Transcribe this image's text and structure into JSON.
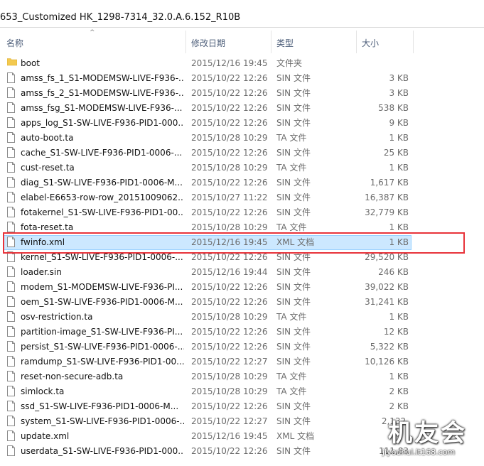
{
  "address_bar": {
    "path": "653_Customized HK_1298-7314_32.0.A.6.152_R10B"
  },
  "columns": {
    "name": "名称",
    "date": "修改日期",
    "type": "类型",
    "size": "大小"
  },
  "selected_index": 12,
  "files": [
    {
      "name": "boot",
      "date": "2015/12/16 19:45",
      "type": "文件夹",
      "size": "",
      "icon": "folder-icon"
    },
    {
      "name": "amss_fs_1_S1-MODEMSW-LIVE-F936-...",
      "date": "2015/10/22 12:26",
      "type": "SIN 文件",
      "size": "3 KB",
      "icon": "file-icon"
    },
    {
      "name": "amss_fs_2_S1-MODEMSW-LIVE-F936-...",
      "date": "2015/10/22 12:26",
      "type": "SIN 文件",
      "size": "3 KB",
      "icon": "file-icon"
    },
    {
      "name": "amss_fsg_S1-MODEMSW-LIVE-F936-...",
      "date": "2015/10/22 12:26",
      "type": "SIN 文件",
      "size": "538 KB",
      "icon": "file-icon"
    },
    {
      "name": "apps_log_S1-SW-LIVE-F936-PID1-000...",
      "date": "2015/10/22 12:26",
      "type": "SIN 文件",
      "size": "9 KB",
      "icon": "file-icon"
    },
    {
      "name": "auto-boot.ta",
      "date": "2015/10/28 10:29",
      "type": "TA 文件",
      "size": "1 KB",
      "icon": "file-icon"
    },
    {
      "name": "cache_S1-SW-LIVE-F936-PID1-0006-...",
      "date": "2015/10/22 12:26",
      "type": "SIN 文件",
      "size": "25 KB",
      "icon": "file-icon"
    },
    {
      "name": "cust-reset.ta",
      "date": "2015/10/28 10:29",
      "type": "TA 文件",
      "size": "1 KB",
      "icon": "file-icon"
    },
    {
      "name": "diag_S1-SW-LIVE-F936-PID1-0006-M...",
      "date": "2015/10/22 12:26",
      "type": "SIN 文件",
      "size": "1,617 KB",
      "icon": "file-icon"
    },
    {
      "name": "elabel-E6653-row-row_20151009062...",
      "date": "2015/10/27 11:22",
      "type": "SIN 文件",
      "size": "16,387 KB",
      "icon": "file-icon"
    },
    {
      "name": "fotakernel_S1-SW-LIVE-F936-PID1-00...",
      "date": "2015/10/22 12:26",
      "type": "SIN 文件",
      "size": "32,779 KB",
      "icon": "file-icon"
    },
    {
      "name": "fota-reset.ta",
      "date": "2015/10/28 10:29",
      "type": "TA 文件",
      "size": "1 KB",
      "icon": "file-icon"
    },
    {
      "name": "fwinfo.xml",
      "date": "2015/12/16 19:45",
      "type": "XML 文档",
      "size": "1 KB",
      "icon": "file-icon"
    },
    {
      "name": "kernel_S1-SW-LIVE-F936-PID1-0006-...",
      "date": "2015/10/22 12:26",
      "type": "SIN 文件",
      "size": "29,520 KB",
      "icon": "file-icon"
    },
    {
      "name": "loader.sin",
      "date": "2015/12/16 19:44",
      "type": "SIN 文件",
      "size": "246 KB",
      "icon": "file-icon"
    },
    {
      "name": "modem_S1-MODEMSW-LIVE-F936-PI...",
      "date": "2015/10/22 12:26",
      "type": "SIN 文件",
      "size": "39,022 KB",
      "icon": "file-icon"
    },
    {
      "name": "oem_S1-SW-LIVE-F936-PID1-0006-M...",
      "date": "2015/10/22 12:26",
      "type": "SIN 文件",
      "size": "31,241 KB",
      "icon": "file-icon"
    },
    {
      "name": "osv-restriction.ta",
      "date": "2015/10/28 10:29",
      "type": "TA 文件",
      "size": "1 KB",
      "icon": "file-icon"
    },
    {
      "name": "partition-image_S1-SW-LIVE-F936-PI...",
      "date": "2015/10/22 12:26",
      "type": "SIN 文件",
      "size": "12 KB",
      "icon": "file-icon"
    },
    {
      "name": "persist_S1-SW-LIVE-F936-PID1-0006-...",
      "date": "2015/10/22 12:26",
      "type": "SIN 文件",
      "size": "5,322 KB",
      "icon": "file-icon"
    },
    {
      "name": "ramdump_S1-SW-LIVE-F936-PID1-00...",
      "date": "2015/10/22 12:27",
      "type": "SIN 文件",
      "size": "10,126 KB",
      "icon": "file-icon"
    },
    {
      "name": "reset-non-secure-adb.ta",
      "date": "2015/10/28 10:29",
      "type": "TA 文件",
      "size": "1 KB",
      "icon": "file-icon"
    },
    {
      "name": "simlock.ta",
      "date": "2015/10/28 10:29",
      "type": "TA 文件",
      "size": "2 KB",
      "icon": "file-icon"
    },
    {
      "name": "ssd_S1-SW-LIVE-F936-PID1-0006-M...",
      "date": "2015/10/22 12:26",
      "type": "SIN 文件",
      "size": "2 KB",
      "icon": "file-icon"
    },
    {
      "name": "system_S1-SW-LIVE-F936-PID1-0006-...",
      "date": "2015/10/22 12:27",
      "type": "SIN 文件",
      "size": "2,132,",
      "icon": "file-icon"
    },
    {
      "name": "update.xml",
      "date": "2015/12/16 19:45",
      "type": "XML 文档",
      "size": "",
      "icon": "file-icon"
    },
    {
      "name": "userdata_S1-SW-LIVE-F936-PID1-000...",
      "date": "2015/10/22 12:26",
      "type": "SIN 文件",
      "size": "111,83",
      "icon": "file-icon"
    }
  ],
  "watermark": {
    "logo_text": "机友会",
    "url": "jiyouhui.it168.com"
  },
  "colors": {
    "selection": "#cce8ff",
    "selection_border": "#99d1ff",
    "highlight": "#e8333a",
    "folder": "#f3c94f"
  }
}
